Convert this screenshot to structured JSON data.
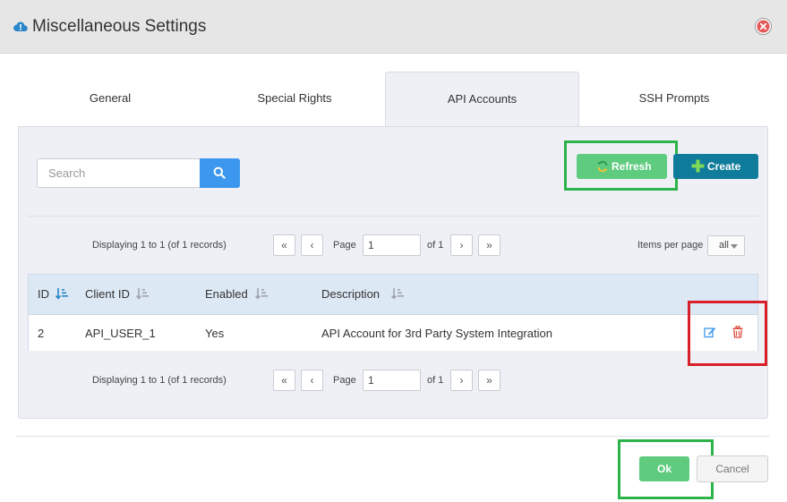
{
  "header": {
    "title": "Miscellaneous Settings",
    "title_icon": "cloud-alert-icon",
    "close_icon": "close-circle-icon"
  },
  "tabs": [
    {
      "label": "General",
      "active": false
    },
    {
      "label": "Special Rights",
      "active": false
    },
    {
      "label": "API Accounts",
      "active": true
    },
    {
      "label": "SSH Prompts",
      "active": false
    }
  ],
  "toolbar": {
    "search_placeholder": "Search",
    "search_icon": "magnifier-icon",
    "refresh_label": "Refresh",
    "create_label": "Create"
  },
  "pager_top": {
    "info": "Displaying 1 to 1 (of 1 records)",
    "page_label": "Page",
    "page_value": "1",
    "of_label": "of 1",
    "first": "«",
    "prev": "‹",
    "next": "›",
    "last": "»",
    "items_per_page_label": "Items per page",
    "items_per_page_value": "all"
  },
  "grid": {
    "columns": [
      "ID",
      "Client ID",
      "Enabled",
      "Description"
    ],
    "rows": [
      {
        "id": "2",
        "client_id": "API_USER_1",
        "enabled": "Yes",
        "description": "API Account for 3rd Party System Integration"
      }
    ]
  },
  "pager_bottom": {
    "info": "Displaying 1 to 1 (of 1 records)",
    "page_label": "Page",
    "page_value": "1",
    "of_label": "of 1",
    "first": "«",
    "prev": "‹",
    "next": "›",
    "last": "»"
  },
  "footer": {
    "ok_label": "Ok",
    "cancel_label": "Cancel"
  },
  "colors": {
    "accent_green": "#5ecb7f",
    "create_teal": "#0f7c9b",
    "search_blue": "#3c97ee",
    "highlight_green": "#2cb34a",
    "highlight_red": "#d9202a",
    "delete_red": "#e0453a",
    "edit_blue": "#3c97ee"
  }
}
